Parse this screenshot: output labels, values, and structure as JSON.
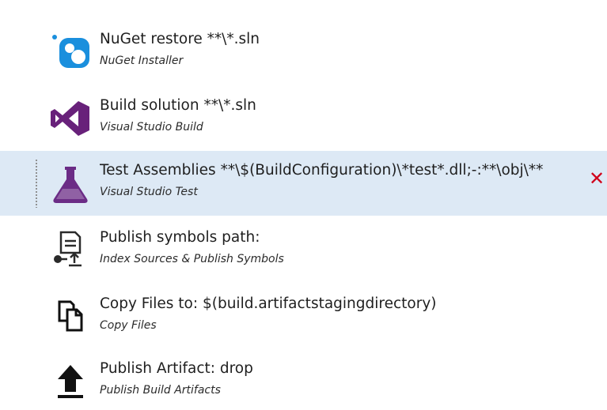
{
  "tasks": [
    {
      "title": "NuGet restore **\\*.sln",
      "subtitle": "NuGet Installer",
      "icon": "nuget-icon"
    },
    {
      "title": "Build solution **\\*.sln",
      "subtitle": "Visual Studio Build",
      "icon": "visual-studio-icon"
    },
    {
      "title": "Test Assemblies **\\$(BuildConfiguration)\\*test*.dll;-:**\\obj\\**",
      "subtitle": "Visual Studio Test",
      "icon": "flask-icon",
      "selected": true
    },
    {
      "title": "Publish symbols path:",
      "subtitle": "Index Sources & Publish Symbols",
      "icon": "publish-symbols-icon"
    },
    {
      "title": "Copy Files to: $(build.artifactstagingdirectory)",
      "subtitle": "Copy Files",
      "icon": "copy-files-icon"
    },
    {
      "title": "Publish Artifact: drop",
      "subtitle": "Publish Build Artifacts",
      "icon": "upload-arrow-icon"
    }
  ],
  "remove_label": "✕",
  "colors": {
    "selected_bg": "#dde9f5",
    "remove": "#d0021b",
    "vs_purple": "#68217a",
    "nuget_blue": "#0f7fc8"
  }
}
